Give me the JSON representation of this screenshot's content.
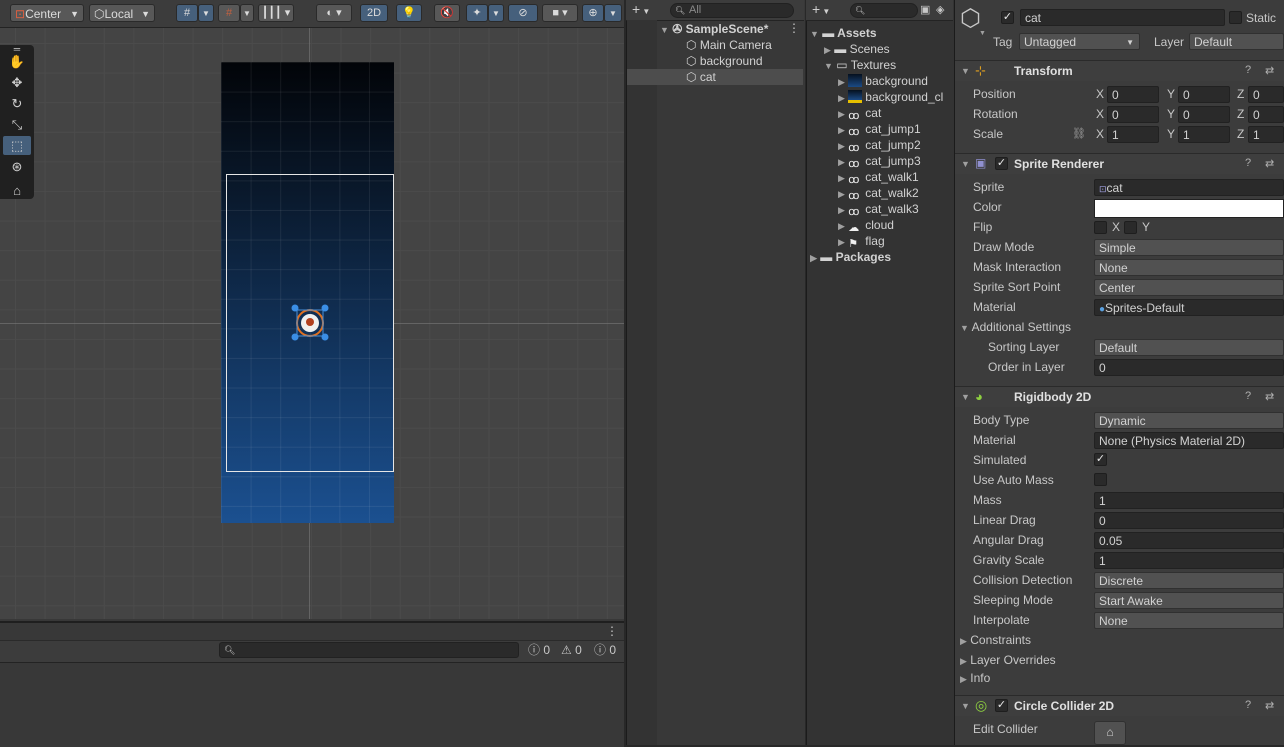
{
  "scene_toolbar": {
    "pivot": "Center",
    "space": "Local",
    "mode_2d": "2D"
  },
  "console": {
    "errors": "0",
    "warnings": "0",
    "messages": "0"
  },
  "hierarchy": {
    "search_placeholder": "All",
    "scene": "SampleScene*",
    "items": [
      "Main Camera",
      "background",
      "cat"
    ]
  },
  "project": {
    "assets": "Assets",
    "scenes": "Scenes",
    "textures": "Textures",
    "textures_items": [
      "background",
      "background_cl",
      "cat",
      "cat_jump1",
      "cat_jump2",
      "cat_jump3",
      "cat_walk1",
      "cat_walk2",
      "cat_walk3",
      "cloud",
      "flag"
    ],
    "packages": "Packages"
  },
  "inspector": {
    "name": "cat",
    "static_label": "Static",
    "tag_label": "Tag",
    "tag_value": "Untagged",
    "layer_label": "Layer",
    "layer_value": "Default",
    "transform": {
      "title": "Transform",
      "position_label": "Position",
      "rotation_label": "Rotation",
      "scale_label": "Scale",
      "x": "X",
      "y": "Y",
      "z": "Z",
      "position": [
        "0",
        "0",
        "0"
      ],
      "rotation": [
        "0",
        "0",
        "0"
      ],
      "scale": [
        "1",
        "1",
        "1"
      ]
    },
    "sprite_renderer": {
      "title": "Sprite Renderer",
      "sprite_label": "Sprite",
      "sprite_value": "cat",
      "color_label": "Color",
      "color_value": "#ffffff",
      "flip_label": "Flip",
      "flip_x": "X",
      "flip_y": "Y",
      "draw_mode_label": "Draw Mode",
      "draw_mode_value": "Simple",
      "mask_label": "Mask Interaction",
      "mask_value": "None",
      "sort_point_label": "Sprite Sort Point",
      "sort_point_value": "Center",
      "material_label": "Material",
      "material_value": "Sprites-Default",
      "additional": "Additional Settings",
      "sorting_layer_label": "Sorting Layer",
      "sorting_layer_value": "Default",
      "order_label": "Order in Layer",
      "order_value": "0"
    },
    "rigidbody": {
      "title": "Rigidbody 2D",
      "body_type_label": "Body Type",
      "body_type_value": "Dynamic",
      "material_label": "Material",
      "material_value": "None (Physics Material 2D)",
      "simulated_label": "Simulated",
      "auto_mass_label": "Use Auto Mass",
      "mass_label": "Mass",
      "mass_value": "1",
      "linear_label": "Linear Drag",
      "linear_value": "0",
      "angular_label": "Angular Drag",
      "angular_value": "0.05",
      "gravity_label": "Gravity Scale",
      "gravity_value": "1",
      "collision_label": "Collision Detection",
      "collision_value": "Discrete",
      "sleeping_label": "Sleeping Mode",
      "sleeping_value": "Start Awake",
      "interpolate_label": "Interpolate",
      "interpolate_value": "None",
      "constraints": "Constraints",
      "layer_overrides": "Layer Overrides",
      "info": "Info"
    },
    "circle_collider": {
      "title": "Circle Collider 2D",
      "edit_label": "Edit Collider"
    }
  }
}
